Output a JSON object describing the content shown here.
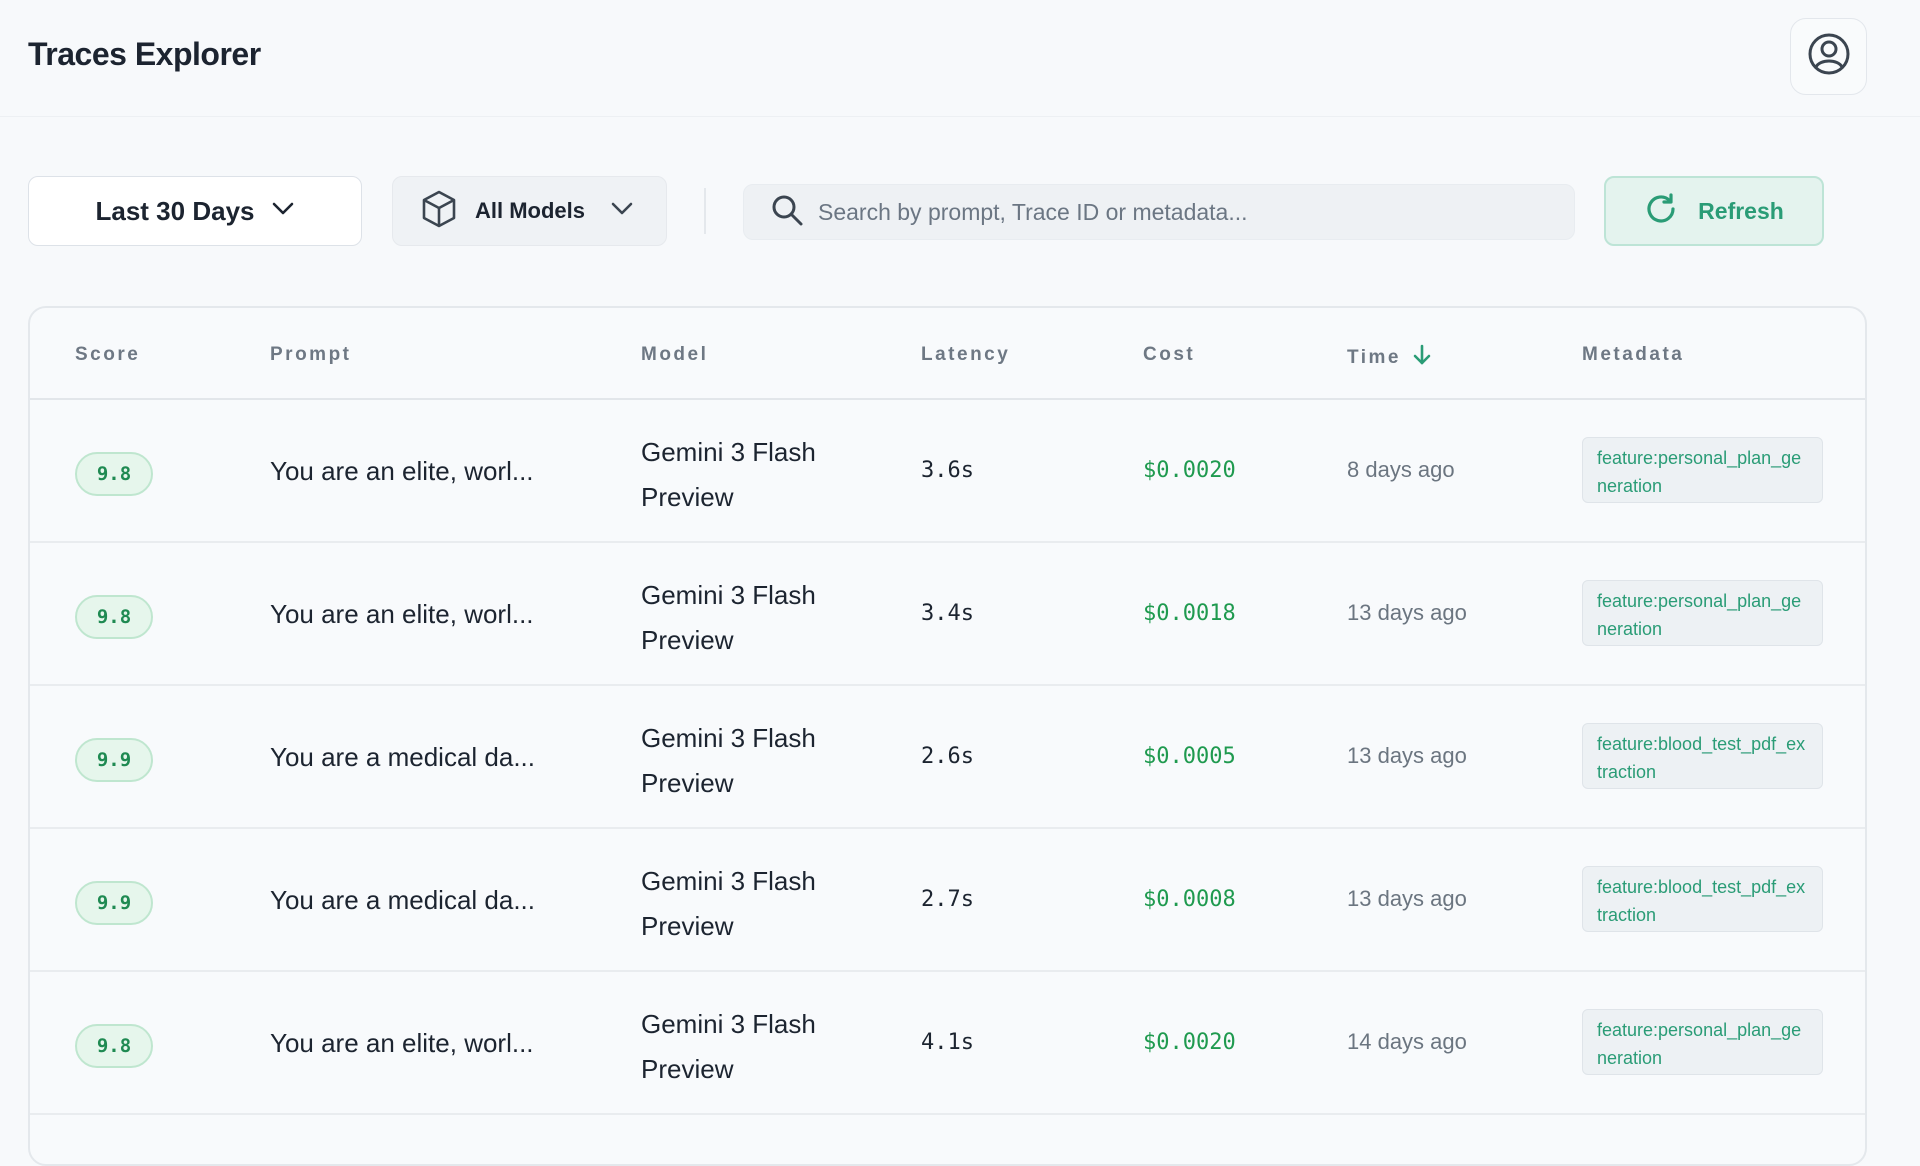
{
  "header": {
    "title": "Traces Explorer",
    "profile_icon": "user-circle-icon"
  },
  "toolbar": {
    "date_range": "Last 30 Days",
    "model_filter": "All Models",
    "search_placeholder": "Search by prompt, Trace ID or metadata...",
    "search_value": "",
    "refresh_label": "Refresh"
  },
  "table": {
    "columns": {
      "score": "Score",
      "prompt": "Prompt",
      "model": "Model",
      "latency": "Latency",
      "cost": "Cost",
      "time": "Time",
      "metadata": "Metadata"
    },
    "sort": {
      "column": "time",
      "direction": "desc"
    },
    "rows": [
      {
        "score": "9.8",
        "prompt": "You are an elite, worl...",
        "model": "Gemini 3 Flash Preview",
        "latency": "3.6s",
        "cost": "$0.0020",
        "time": "8 days ago",
        "metadata": "feature:personal_plan_generation"
      },
      {
        "score": "9.8",
        "prompt": "You are an elite, worl...",
        "model": "Gemini 3 Flash Preview",
        "latency": "3.4s",
        "cost": "$0.0018",
        "time": "13 days ago",
        "metadata": "feature:personal_plan_generation"
      },
      {
        "score": "9.9",
        "prompt": "You are a medical da...",
        "model": "Gemini 3 Flash Preview",
        "latency": "2.6s",
        "cost": "$0.0005",
        "time": "13 days ago",
        "metadata": "feature:blood_test_pdf_extraction"
      },
      {
        "score": "9.9",
        "prompt": "You are a medical da...",
        "model": "Gemini 3 Flash Preview",
        "latency": "2.7s",
        "cost": "$0.0008",
        "time": "13 days ago",
        "metadata": "feature:blood_test_pdf_extraction"
      },
      {
        "score": "9.8",
        "prompt": "You are an elite, worl...",
        "model": "Gemini 3 Flash Preview",
        "latency": "4.1s",
        "cost": "$0.0020",
        "time": "14 days ago",
        "metadata": "feature:personal_plan_generation"
      }
    ]
  },
  "colors": {
    "accent": "#2a9c76",
    "score_green": "#1f8a52",
    "cost_green": "#1f9a4f",
    "background": "#f7f9fb"
  }
}
